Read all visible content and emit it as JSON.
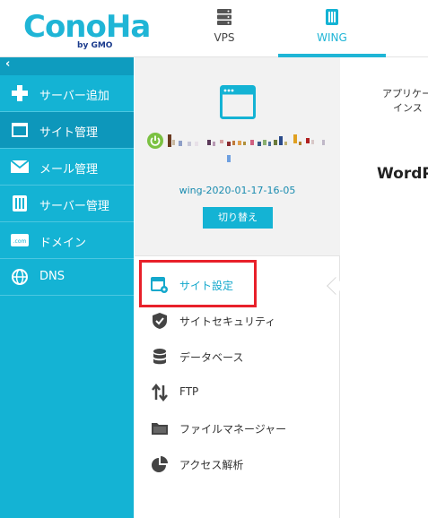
{
  "header": {
    "logo_text": "ConoHa",
    "logo_sub": "by GMO",
    "tabs": [
      {
        "label": "VPS",
        "icon": "server-icon",
        "active": false
      },
      {
        "label": "WING",
        "icon": "wing-server-icon",
        "active": true
      }
    ]
  },
  "sidebar": {
    "collapse_label": "‹",
    "items": [
      {
        "label": "サーバー追加",
        "icon": "plus-icon",
        "active": false
      },
      {
        "label": "サイト管理",
        "icon": "window-icon",
        "active": true
      },
      {
        "label": "メール管理",
        "icon": "mail-icon",
        "active": false
      },
      {
        "label": "サーバー管理",
        "icon": "server-manage-icon",
        "active": false
      },
      {
        "label": "ドメイン",
        "icon": "domain-icon",
        "active": false
      },
      {
        "label": "DNS",
        "icon": "globe-icon",
        "active": false
      }
    ]
  },
  "site": {
    "server_name": "wing-2020-01-17-16-05",
    "switch_button": "切り替え",
    "status": "on"
  },
  "site_menu": [
    {
      "label": "サイト設定",
      "icon": "site-settings-icon",
      "active": true
    },
    {
      "label": "サイトセキュリティ",
      "icon": "shield-check-icon",
      "active": false
    },
    {
      "label": "データベース",
      "icon": "database-icon",
      "active": false
    },
    {
      "label": "FTP",
      "icon": "transfer-arrows-icon",
      "active": false
    },
    {
      "label": "ファイルマネージャー",
      "icon": "folder-icon",
      "active": false
    },
    {
      "label": "アクセス解析",
      "icon": "pie-chart-icon",
      "active": false
    }
  ],
  "main": {
    "hint_line1": "アプリケー",
    "hint_line2": "インス",
    "section_title": "WordP"
  },
  "colors": {
    "accent": "#14b3d4",
    "sidebar_active": "#0d97bb",
    "highlight": "#e8202a",
    "power": "#7bc142"
  }
}
